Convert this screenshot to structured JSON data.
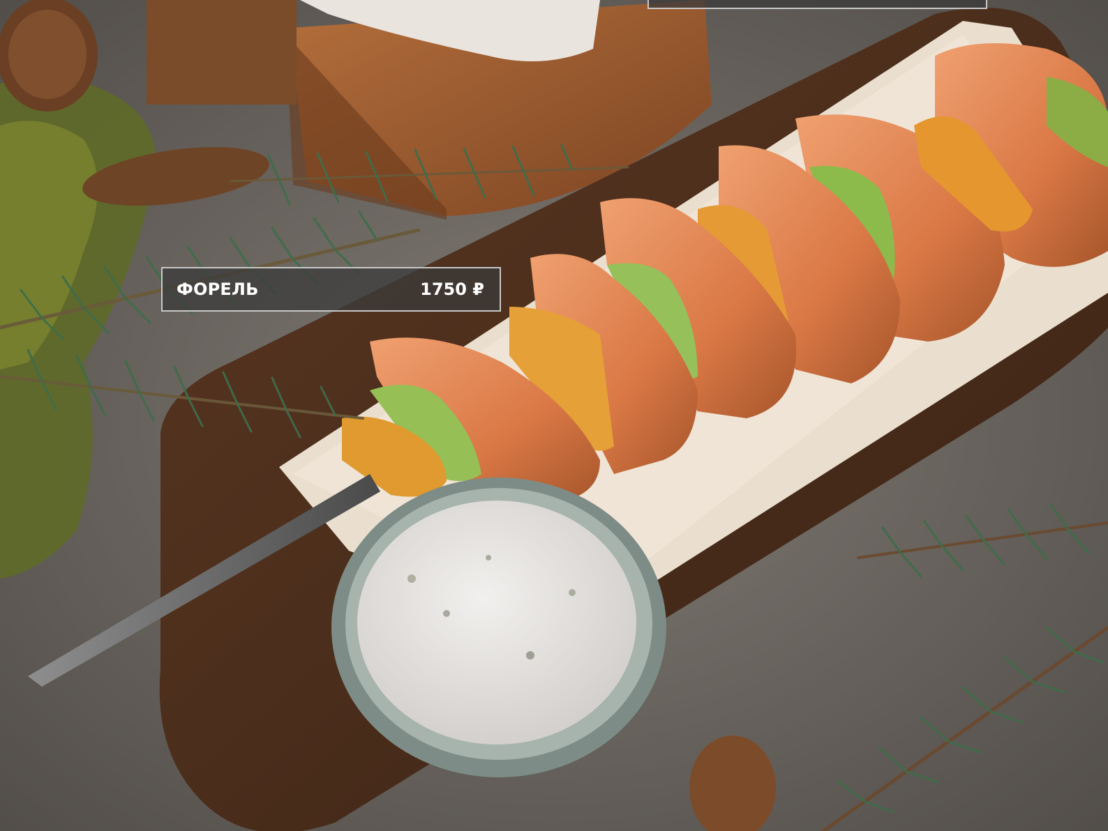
{
  "menu_item": {
    "name": "ФОРЕЛЬ",
    "price": "1750 ₽"
  },
  "colors": {
    "card_background": "#3a3a3abd",
    "card_border": "#c9c9c9",
    "card_text": "#ffffff",
    "table_surface": "#6b6762",
    "board_wood": "#4a2e1c"
  }
}
